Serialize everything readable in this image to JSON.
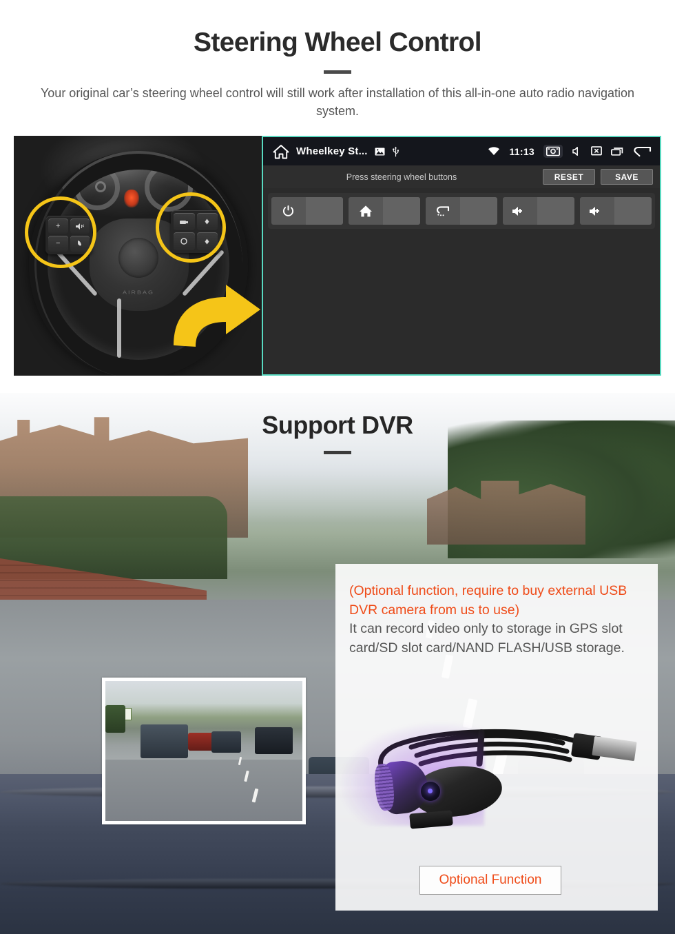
{
  "section_swc": {
    "title": "Steering Wheel Control",
    "subtitle": "Your original car’s steering wheel control will still work after installation of this all-in-one auto radio navigation system.",
    "wheel_photo": {
      "alt": "Car steering wheel with two highlighted button pads",
      "highlight_color": "#F5C518",
      "arrow_color": "#F5C518",
      "left_pad_keys": [
        "+",
        "−",
        "voice",
        "call"
      ],
      "right_pad_keys": [
        "media",
        "up",
        "circle",
        "down"
      ],
      "hub_text": "AIRBAG"
    },
    "android": {
      "border_color": "#58d9c0",
      "statusbar": {
        "home_icon": "home-icon",
        "app_title": "Wheelkey St...",
        "image_icon": "image-icon",
        "usb_icon": "usb-icon",
        "wifi_icon": "wifi-icon",
        "time": "11:13",
        "screenshot_icon": "screenshot-icon",
        "volume_icon": "volume-icon",
        "screen_off_icon": "screen-off-icon",
        "recents_icon": "recents-icon",
        "back_icon": "back-icon"
      },
      "command_bar": {
        "hint": "Press steering wheel buttons",
        "reset_label": "RESET",
        "save_label": "SAVE"
      },
      "key_slots": [
        {
          "icon": "power-icon",
          "value": ""
        },
        {
          "icon": "home-icon",
          "value": ""
        },
        {
          "icon": "back-icon",
          "value": ""
        },
        {
          "icon": "volume-up-icon",
          "value": ""
        },
        {
          "icon": "volume-up-icon",
          "value": ""
        }
      ]
    }
  },
  "section_dvr": {
    "title": "Support DVR",
    "background_alt": "Dashcam view of a residential street with parked cars, seen over a car dashboard",
    "inset_alt": "Dashcam recorded still of the same street scene",
    "info_panel": {
      "optional_notice": "(Optional function, require to buy external USB DVR camera from us to use)",
      "description": "It can record video only to storage in GPS slot card/SD slot card/NAND FLASH/USB storage.",
      "notice_color": "#ef4b18",
      "description_color": "#555555",
      "camera_alt": "USB DVR camera with coiled black cable and USB type-A plug",
      "button_label": "Optional Function"
    }
  }
}
